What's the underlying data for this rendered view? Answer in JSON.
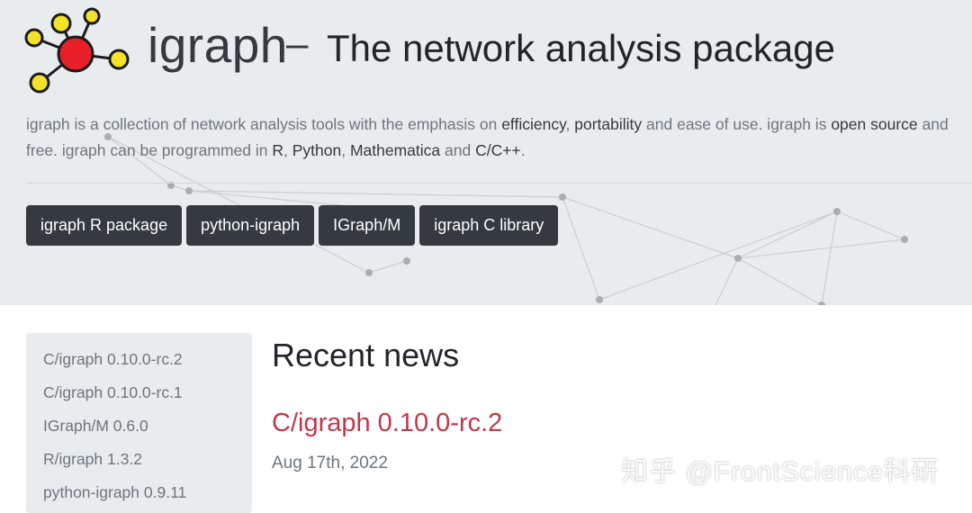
{
  "header": {
    "logo_word": "igraph",
    "dash": "–",
    "tagline": "The network analysis package"
  },
  "lead": {
    "p1": "igraph is a collection of network analysis tools with the emphasis on ",
    "efficiency": "efficiency",
    "comma1": ", ",
    "portability": "portability",
    "p2": " and ease of use. igraph is ",
    "open_source": "open source",
    "p3": " and free. igraph can be programmed in ",
    "r": "R",
    "comma2": ", ",
    "python": "Python",
    "comma3": ", ",
    "mathematica": "Mathematica",
    "and": " and ",
    "c": "C/C++",
    "end": "."
  },
  "buttons": {
    "r_package": "igraph R package",
    "python": "python-igraph",
    "igraphm": "IGraph/M",
    "c_library": "igraph C library"
  },
  "sidebar": {
    "items": [
      "C/igraph 0.10.0-rc.2",
      "C/igraph 0.10.0-rc.1",
      "IGraph/M 0.6.0",
      "R/igraph 1.3.2",
      "python-igraph 0.9.11"
    ]
  },
  "news": {
    "heading": "Recent news",
    "post_title": "C/igraph 0.10.0-rc.2",
    "post_date": "Aug 17th, 2022"
  },
  "watermark": "知乎 @FrontScience科研",
  "colors": {
    "hero_bg": "#e9ecef",
    "button_bg": "#343a40",
    "post_title": "#c0384a",
    "logo_center": "#e8202a",
    "logo_nodes": "#f4e22a"
  }
}
